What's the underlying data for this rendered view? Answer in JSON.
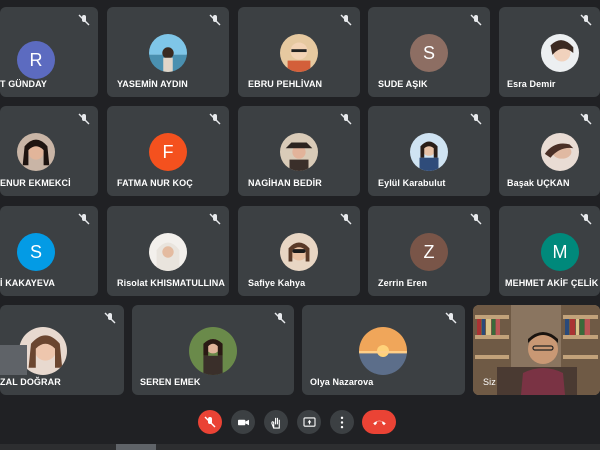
{
  "participants": [
    {
      "name": "T GÜNDAY",
      "initial": "R",
      "avatar_color": "#5c6bc0"
    },
    {
      "name": "YASEMİN AYDIN",
      "photo": "photo-beach"
    },
    {
      "name": "EBRU PEHLİVAN",
      "photo": "photo-girl-glasses"
    },
    {
      "name": "SUDE AŞIK",
      "initial": "S",
      "avatar_color": "#8d6e63"
    },
    {
      "name": "Esra Demir",
      "photo": "photo-woman-light"
    },
    {
      "name": "ENUR EKMEKCİ",
      "photo": "photo-woman-dark"
    },
    {
      "name": "FATMA NUR KOÇ",
      "initial": "F",
      "avatar_color": "#f4511e"
    },
    {
      "name": "NAGİHAN BEDİR",
      "photo": "photo-woman-hat"
    },
    {
      "name": "Eylül Karabulut",
      "photo": "photo-woman-blue"
    },
    {
      "name": "Başak UÇKAN",
      "photo": "photo-woman-lying"
    },
    {
      "name": "İ KAKAYEVA",
      "initial": "S",
      "avatar_color": "#039be5"
    },
    {
      "name": "Risolat KHISMATULLINA",
      "photo": "photo-woman-hijab"
    },
    {
      "name": "Safiye Kahya",
      "photo": "photo-woman-sunglasses"
    },
    {
      "name": "Zerrin Eren",
      "initial": "Z",
      "avatar_color": "#795548"
    },
    {
      "name": "MEHMET AKİF ÇELİK",
      "initial": "M",
      "avatar_color": "#00897b"
    },
    {
      "name": "ZAL DOĞRAR",
      "photo": "photo-woman-smile"
    },
    {
      "name": "SEREN EMEK",
      "photo": "photo-woman-outdoor"
    },
    {
      "name": "Olya Nazarova",
      "photo": "photo-sunset"
    },
    {
      "name": "Siz",
      "photo": "photo-self"
    }
  ],
  "toolbar": {
    "buttons": [
      "mic-off-icon",
      "camera-icon",
      "raise-hand-icon",
      "present-icon",
      "more-icon",
      "end-call-icon"
    ]
  },
  "colors": {
    "background": "#202124",
    "tile": "#3c4043",
    "danger": "#ea4335"
  }
}
